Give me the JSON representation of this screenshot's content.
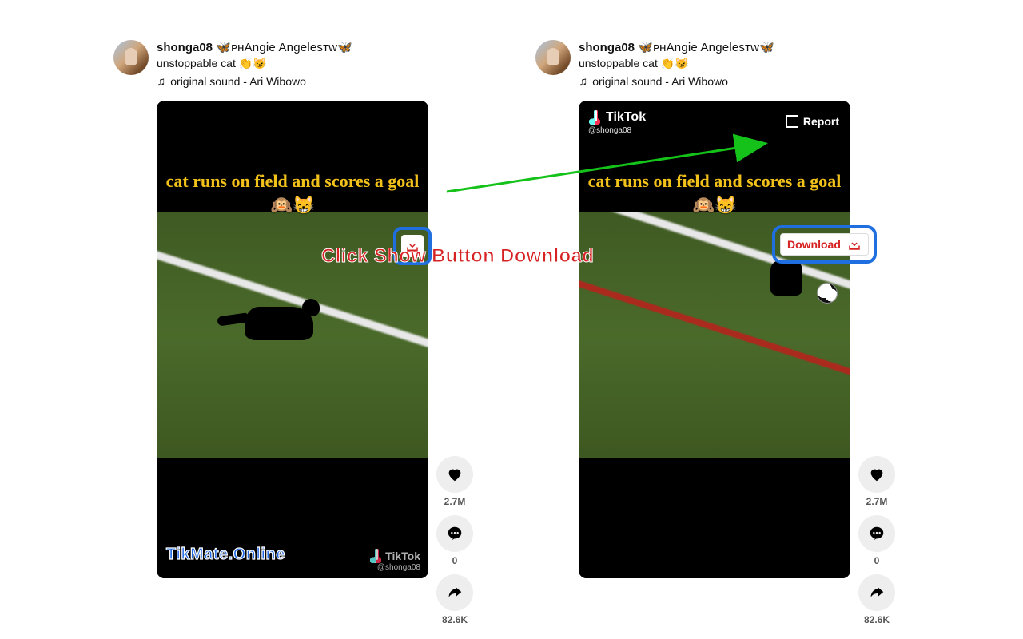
{
  "user": {
    "username": "shonga08",
    "display_suffix": "🦋ᴘʜAngie Angelesᴛᴡ🦋"
  },
  "caption_text": "unstoppable cat 👏😼",
  "music": {
    "label": "original sound - Ari Wibowo"
  },
  "video_caption": "cat runs on field and scores a goal 🙉😸",
  "tiktok": {
    "brand": "TikTok",
    "handle": "@shonga08"
  },
  "report_label": "Report",
  "download_button_label": "Download",
  "watermark_site": "TikMate.Online",
  "actions": {
    "likes": "2.7M",
    "comments": "0",
    "shares": "82.6K"
  },
  "annotation_text": "Click Show Button Download"
}
